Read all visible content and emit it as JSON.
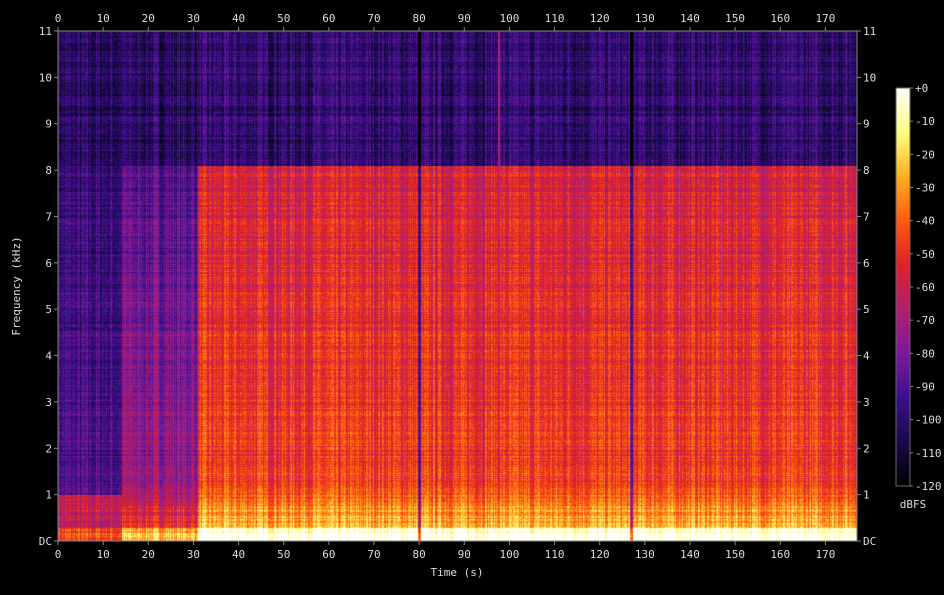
{
  "chart_data": {
    "type": "heatmap",
    "title": "",
    "xlabel": "Time (s)",
    "ylabel": "Frequency (kHz)",
    "xlim": [
      0,
      177
    ],
    "ylim": [
      0,
      11
    ],
    "x_ticks": [
      "0",
      "10",
      "20",
      "30",
      "40",
      "50",
      "60",
      "70",
      "80",
      "90",
      "100",
      "110",
      "120",
      "130",
      "140",
      "150",
      "160",
      "170"
    ],
    "y_ticks": [
      "DC",
      "1",
      "2",
      "3",
      "4",
      "5",
      "6",
      "7",
      "8",
      "9",
      "10",
      "11"
    ],
    "colorbar": {
      "label": "dBFS",
      "range": [
        -120,
        0
      ],
      "ticks": [
        "+0",
        "-10",
        "-20",
        "-30",
        "-40",
        "-50",
        "-60",
        "-70",
        "-80",
        "-90",
        "-100",
        "-110",
        "-120"
      ],
      "colormap": [
        "#000000",
        "#1a0a4a",
        "#3b0f8c",
        "#7a1a9a",
        "#b01f6f",
        "#e0202a",
        "#ff5a10",
        "#ffb020",
        "#ffff80",
        "#ffffff"
      ]
    },
    "bandwidth_cutoff_khz": 8.1,
    "segments": [
      {
        "start": 0,
        "end": 14,
        "level": "low"
      },
      {
        "start": 14,
        "end": 31,
        "level": "medium"
      },
      {
        "start": 31,
        "end": 80,
        "level": "high"
      },
      {
        "start": 80,
        "end": 127,
        "level": "high"
      },
      {
        "start": 127,
        "end": 176,
        "level": "high"
      }
    ],
    "gaps_s": [
      80,
      127
    ],
    "transient_s": 97.5
  }
}
